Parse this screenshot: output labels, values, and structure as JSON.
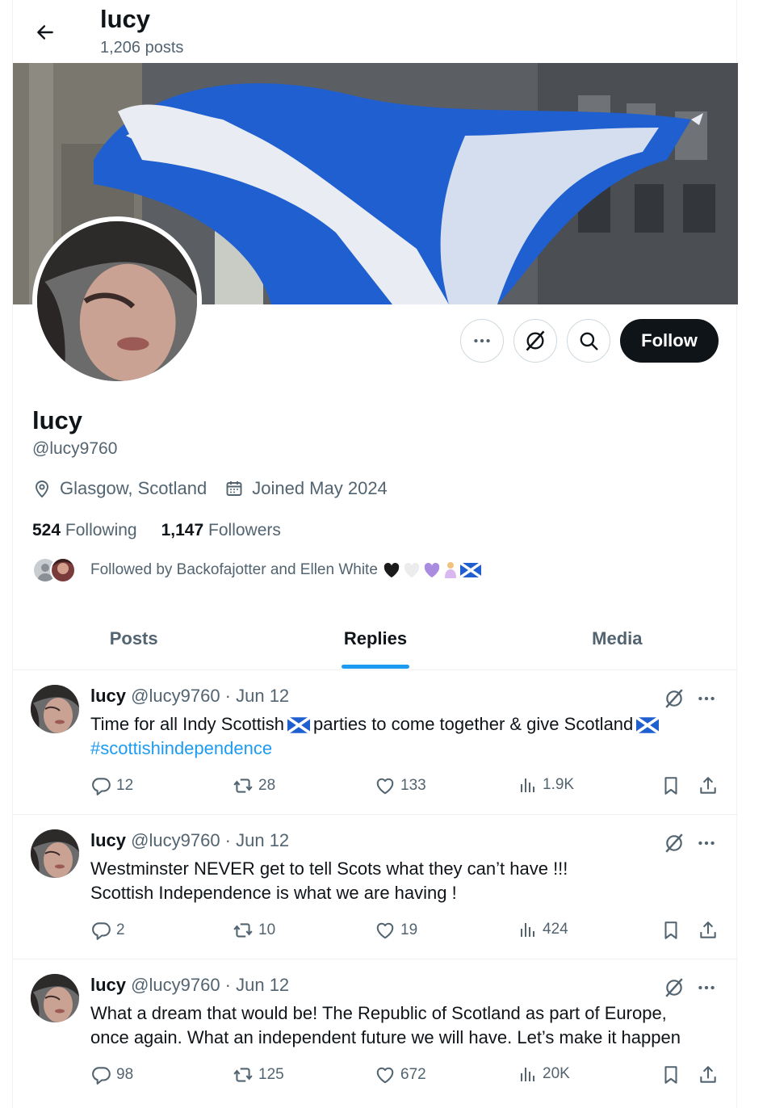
{
  "header": {
    "name": "lucy",
    "post_count": "1,206 posts"
  },
  "profile": {
    "name": "lucy",
    "handle": "@lucy9760",
    "location": "Glasgow, Scotland",
    "joined": "Joined May 2024",
    "following_count": "524",
    "following_label": "Following",
    "followers_count": "1,147",
    "followers_label": "Followers",
    "followed_by": "Followed by Backofajotter and Ellen White",
    "follow_label": "Follow"
  },
  "tabs": [
    {
      "label": "Posts",
      "active": false
    },
    {
      "label": "Replies",
      "active": true
    },
    {
      "label": "Media",
      "active": false
    }
  ],
  "posts": [
    {
      "name": "lucy",
      "meta": "@lucy9760 · Jun 12",
      "text_1": "Time for all Indy Scottish",
      "text_2": "parties to come together & give Scotland",
      "hashtag": "#scottishindependence",
      "replies": "12",
      "reposts": "28",
      "likes": "133",
      "views": "1.9K"
    },
    {
      "name": "lucy",
      "meta": "@lucy9760 · Jun 12",
      "line_1": "Westminster NEVER get to tell Scots what they can’t have !!!",
      "line_2": "Scottish Independence is what we are having !",
      "replies": "2",
      "reposts": "10",
      "likes": "19",
      "views": "424"
    },
    {
      "name": "lucy",
      "meta": "@lucy9760 · Jun 12",
      "line_1": "What a dream that would be! The Republic of Scotland as part of Europe,",
      "line_2": "once again. What an independent future we will have. Let’s make it happen",
      "replies": "98",
      "reposts": "125",
      "likes": "672",
      "views": "20K"
    }
  ],
  "colors": {
    "accent": "#1d9bf0",
    "text": "#0f1419",
    "secondary": "#536471",
    "border": "#eff3f4",
    "flag_blue": "#1f5fcf"
  },
  "icons": [
    "back-arrow-icon",
    "more-icon",
    "grok-icon",
    "search-icon",
    "location-pin-icon",
    "calendar-icon",
    "reply-icon",
    "repost-icon",
    "like-icon",
    "views-icon",
    "bookmark-icon",
    "share-icon",
    "scotland-flag-icon"
  ]
}
